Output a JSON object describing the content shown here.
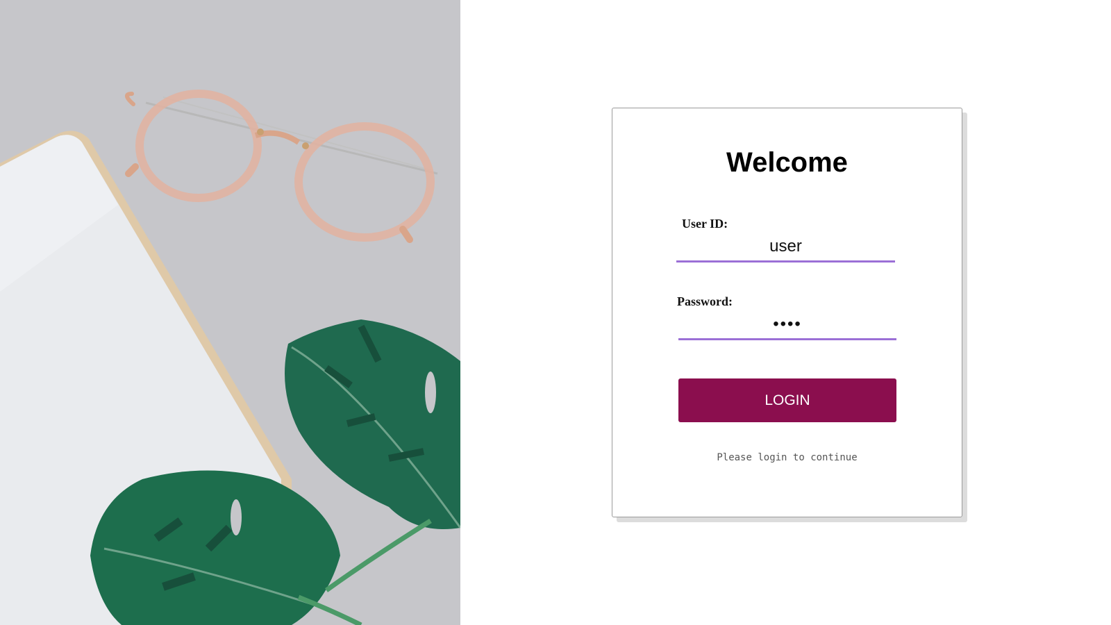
{
  "background": {
    "panel_color": "#c6c6ca",
    "objects": [
      "notebook",
      "eyeglasses",
      "monstera-leaf",
      "monstera-leaf"
    ]
  },
  "login_card": {
    "title": "Welcome",
    "user_id": {
      "label": "User ID:",
      "value": "user"
    },
    "password": {
      "label": "Password:",
      "value": "••••"
    },
    "login_button_label": "LOGIN",
    "hint": "Please login to continue"
  },
  "colors": {
    "accent_underline": "#9b6fd6",
    "button": "#8b0e4e",
    "button_text": "#ffffff"
  }
}
